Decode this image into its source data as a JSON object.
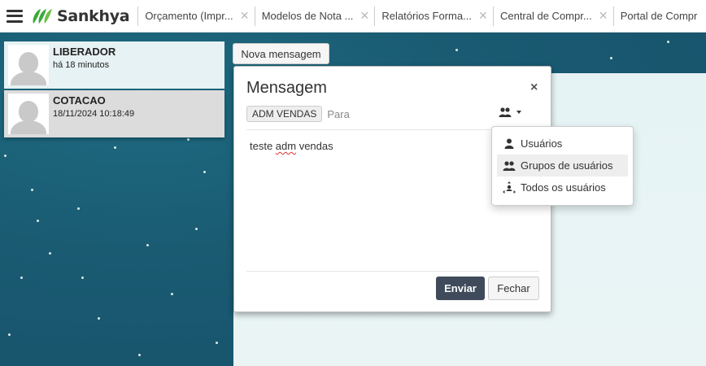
{
  "app": {
    "brand": "Sankhya"
  },
  "tabs": [
    {
      "label": "Orçamento (Impr...",
      "close": "✕"
    },
    {
      "label": "Modelos de Nota ...",
      "close": "✕"
    },
    {
      "label": "Relatórios Forma...",
      "close": "✕"
    },
    {
      "label": "Central de Compr...",
      "close": "✕"
    },
    {
      "label": "Portal de Compr",
      "close": ""
    }
  ],
  "users": [
    {
      "name": "LIBERADOR",
      "time": "há 18 minutos"
    },
    {
      "name": "COTACAO",
      "time": "18/11/2024 10:18:49"
    }
  ],
  "toolbar": {
    "nova_mensagem_label": "Nova mensagem"
  },
  "modal": {
    "title": "Mensagem",
    "close": "×",
    "recipient_chip": "ADM VENDAS",
    "to_placeholder": "Para",
    "message_prefix": "teste ",
    "message_flagged": "adm",
    "message_suffix": " vendas",
    "send_label": "Enviar",
    "close_label": "Fechar"
  },
  "recipient_menu": {
    "items": [
      {
        "label": "Usuários",
        "icon": "user-icon"
      },
      {
        "label": "Grupos de usuários",
        "icon": "group-icon"
      },
      {
        "label": "Todos os usuários",
        "icon": "all-users-icon"
      }
    ],
    "highlighted_index": 1
  },
  "colors": {
    "send_button": "#3f4b5b",
    "brand_green": "#3aaa35",
    "background_teal": "#1d6a80"
  }
}
